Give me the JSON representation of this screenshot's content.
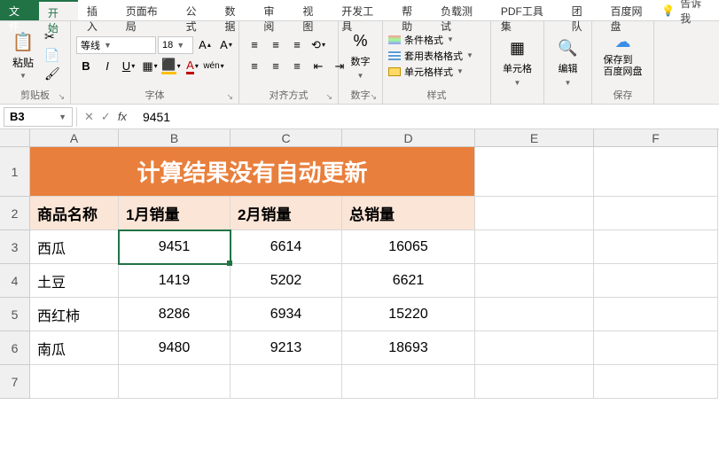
{
  "menu": {
    "file": "文件",
    "tabs": [
      "开始",
      "插入",
      "页面布局",
      "公式",
      "数据",
      "审阅",
      "视图",
      "开发工具",
      "帮助",
      "负载测试",
      "PDF工具集",
      "团队",
      "百度网盘"
    ],
    "tell": "告诉我"
  },
  "ribbon": {
    "clipboard": {
      "paste": "粘贴",
      "label": "剪贴板"
    },
    "font": {
      "name": "等线",
      "size": "18",
      "label": "字体"
    },
    "align": {
      "label": "对齐方式"
    },
    "number": {
      "btn": "数字",
      "label": "数字"
    },
    "styles": {
      "cond": "条件格式",
      "table": "套用表格格式",
      "cell": "单元格样式",
      "label": "样式"
    },
    "cells": {
      "btn": "单元格",
      "label": ""
    },
    "edit": {
      "btn": "编辑",
      "label": ""
    },
    "save": {
      "btn": "保存到\n百度网盘",
      "label": "保存"
    }
  },
  "formula": {
    "ref": "B3",
    "value": "9451"
  },
  "grid": {
    "cols": [
      "A",
      "B",
      "C",
      "D",
      "E",
      "F"
    ],
    "rows": [
      "1",
      "2",
      "3",
      "4",
      "5",
      "6",
      "7"
    ],
    "title": "计算结果没有自动更新",
    "headers": [
      "商品名称",
      "1月销量",
      "2月销量",
      "总销量"
    ],
    "data": [
      {
        "name": "西瓜",
        "m1": "9451",
        "m2": "6614",
        "tot": "16065"
      },
      {
        "name": "土豆",
        "m1": "1419",
        "m2": "5202",
        "tot": "6621"
      },
      {
        "name": "西红柿",
        "m1": "8286",
        "m2": "6934",
        "tot": "15220"
      },
      {
        "name": "南瓜",
        "m1": "9480",
        "m2": "9213",
        "tot": "18693"
      }
    ]
  },
  "chart_data": {
    "type": "table",
    "title": "计算结果没有自动更新",
    "columns": [
      "商品名称",
      "1月销量",
      "2月销量",
      "总销量"
    ],
    "rows": [
      [
        "西瓜",
        9451,
        6614,
        16065
      ],
      [
        "土豆",
        1419,
        5202,
        6621
      ],
      [
        "西红柿",
        8286,
        6934,
        15220
      ],
      [
        "南瓜",
        9480,
        9213,
        18693
      ]
    ]
  }
}
